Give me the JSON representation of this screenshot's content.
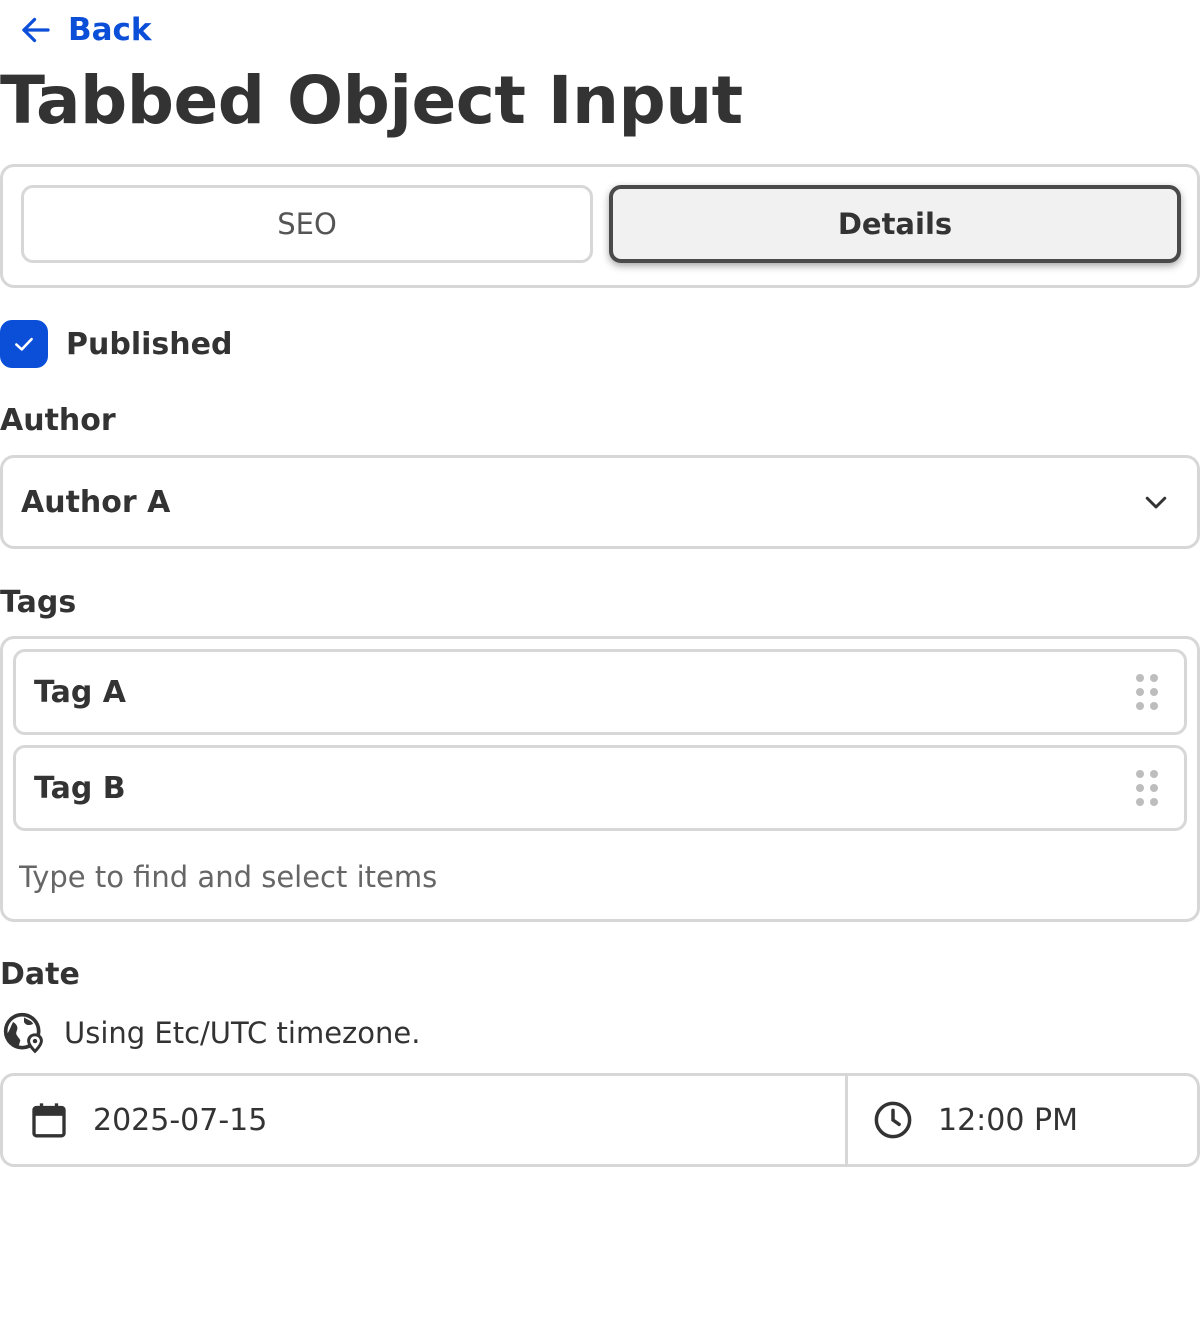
{
  "nav": {
    "back_label": "Back"
  },
  "page": {
    "title": "Tabbed Object Input"
  },
  "tabs": [
    {
      "label": "SEO",
      "active": false
    },
    {
      "label": "Details",
      "active": true
    }
  ],
  "published": {
    "label": "Published",
    "checked": true
  },
  "author": {
    "label": "Author",
    "value": "Author A"
  },
  "tags": {
    "label": "Tags",
    "items": [
      "Tag A",
      "Tag B"
    ],
    "placeholder": "Type to find and select items"
  },
  "date": {
    "label": "Date",
    "timezone_note": "Using Etc/UTC timezone.",
    "date_value": "2025-07-15",
    "time_value": "12:00 PM"
  },
  "colors": {
    "accent": "#0b4ed8",
    "border": "#d7d7d7",
    "text": "#333333"
  }
}
